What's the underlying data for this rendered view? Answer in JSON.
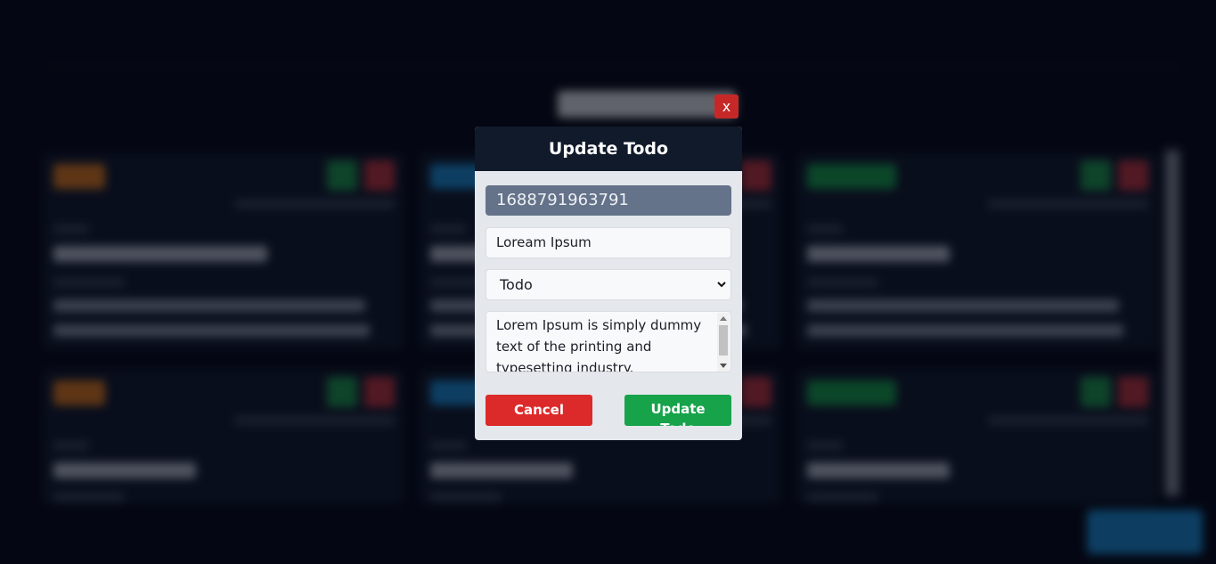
{
  "modal": {
    "title": "Update Todo",
    "close_label": "x",
    "id_value": "1688791963791",
    "title_value": "Loream Ipsum",
    "status_value": "Todo",
    "description_value": "Lorem Ipsum is simply dummy text of the printing and typesetting industry.",
    "cancel_label": "Cancel",
    "update_label": "Update Todo"
  },
  "icons": {
    "close": "close-icon",
    "select_chevron": "chevron-down-icon"
  },
  "colors": {
    "page_background": "#050914",
    "modal_header": "#111a2b",
    "modal_body": "#e4e7eb",
    "id_field": "#64738a",
    "cancel": "#dc2a2a",
    "update": "#16a34a",
    "close": "#c62828"
  }
}
